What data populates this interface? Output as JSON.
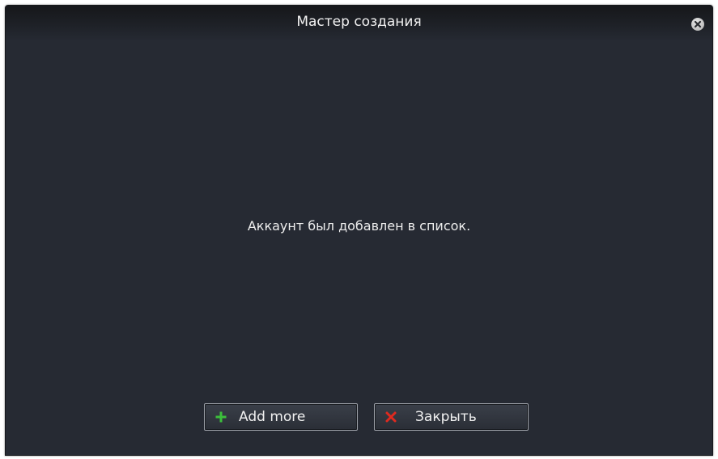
{
  "window": {
    "title": "Мастер создания"
  },
  "content": {
    "message": "Аккаунт был добавлен в список."
  },
  "buttons": {
    "add_more_label": "Add more",
    "close_label": "Закрыть"
  },
  "icons": {
    "window_close": "close-circle-icon",
    "add_more": "plus-icon",
    "close": "x-icon"
  },
  "colors": {
    "background": "#262a33",
    "plus": "#3cbf3c",
    "x": "#e02a1f"
  }
}
